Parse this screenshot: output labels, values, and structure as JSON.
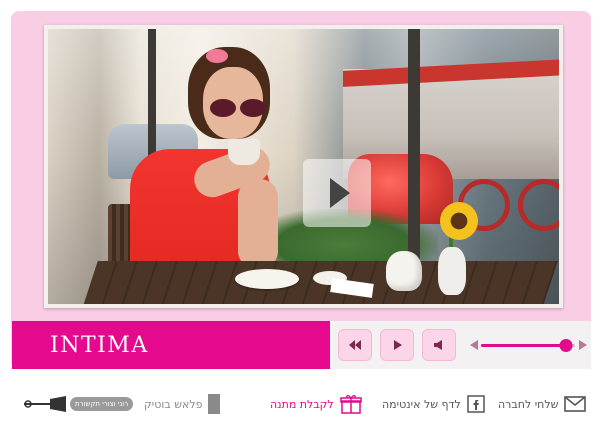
{
  "player": {
    "brand_label": "INTIMA",
    "controls": {
      "rewind_icon": "double-left-arrow-icon",
      "play_icon": "play-icon",
      "volume_icon": "speaker-icon",
      "volume_level": 0.9
    }
  },
  "footer": {
    "share_friend": "שלחי לחברה",
    "facebook_page": "לדף של אינטימה",
    "gift": "לקבלת מתנה",
    "flash_boutique": "פלאש בוטיק",
    "logo_text": "רוני וצורי תקשורת"
  },
  "colors": {
    "accent": "#e4098d",
    "frame": "#f9cde4",
    "button_bg": "#fbd6e8"
  }
}
